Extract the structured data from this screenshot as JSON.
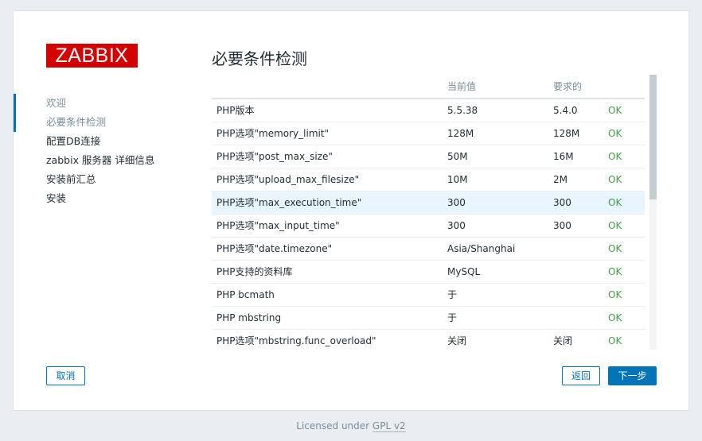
{
  "logo": {
    "text": "ZABBIX"
  },
  "sidebar": {
    "steps": [
      {
        "label": "欢迎"
      },
      {
        "label": "必要条件检测"
      },
      {
        "label": "配置DB连接"
      },
      {
        "label": "zabbix 服务器 详细信息"
      },
      {
        "label": "安装前汇总"
      },
      {
        "label": "安装"
      }
    ]
  },
  "main": {
    "title": "必要条件检测",
    "table": {
      "headers": [
        "",
        "当前值",
        "要求的",
        ""
      ],
      "rows": [
        {
          "name": "PHP版本",
          "current": "5.5.38",
          "required": "5.4.0",
          "status": "OK"
        },
        {
          "name": "PHP选项\"memory_limit\"",
          "current": "128M",
          "required": "128M",
          "status": "OK"
        },
        {
          "name": "PHP选项\"post_max_size\"",
          "current": "50M",
          "required": "16M",
          "status": "OK"
        },
        {
          "name": "PHP选项\"upload_max_filesize\"",
          "current": "10M",
          "required": "2M",
          "status": "OK"
        },
        {
          "name": "PHP选项\"max_execution_time\"",
          "current": "300",
          "required": "300",
          "status": "OK"
        },
        {
          "name": "PHP选项\"max_input_time\"",
          "current": "300",
          "required": "300",
          "status": "OK"
        },
        {
          "name": "PHP选项\"date.timezone\"",
          "current": "Asia/Shanghai",
          "required": "",
          "status": "OK"
        },
        {
          "name": "PHP支持的资料库",
          "current": "MySQL",
          "required": "",
          "status": "OK"
        },
        {
          "name": "PHP bcmath",
          "current": "于",
          "required": "",
          "status": "OK"
        },
        {
          "name": "PHP mbstring",
          "current": "于",
          "required": "",
          "status": "OK"
        },
        {
          "name": "PHP选项\"mbstring.func_overload\"",
          "current": "关闭",
          "required": "关闭",
          "status": "OK"
        }
      ]
    }
  },
  "buttons": {
    "cancel": "取消",
    "back": "返回",
    "next": "下一步"
  },
  "footer": {
    "text": "Licensed under ",
    "link": "GPL v2"
  },
  "colors": {
    "brand": "#d40000",
    "accent": "#0275b8",
    "ok": "#429e47",
    "highlight_row": "#e8f5ff"
  }
}
